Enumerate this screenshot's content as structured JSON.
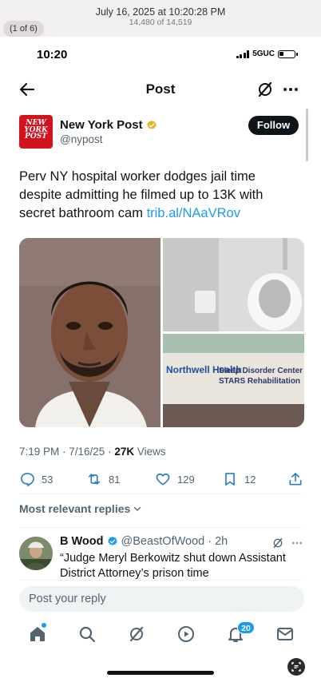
{
  "viewer": {
    "date": "July 16, 2025 at 10:20:28 PM",
    "count": "14,480 of 14,519",
    "pill": "(1 of 6)"
  },
  "status_bar": {
    "time": "10:20",
    "network": "5GUC",
    "battery_level": 0.3
  },
  "nav": {
    "title": "Post",
    "back_icon": "arrow-left-icon",
    "grok_icon": "grok-icon",
    "more_icon": "more-dots-icon"
  },
  "author": {
    "name": "New York Post",
    "handle": "@nypost",
    "avatar_text": "NEW YORK POST",
    "follow_label": "Follow",
    "verified_color": "#e8b42a"
  },
  "tweet": {
    "text": "Perv NY hospital worker dodges jail time despite admitting he filmed up to 13K with secret bathroom cam ",
    "link": "trib.al/NAaVRov",
    "timestamp": "7:19 PM · 7/16/25 · ",
    "views_count": "27K",
    "views_label": " Views"
  },
  "media": {
    "sign_logo": "Northwell Health",
    "sign_text": "Sleep Disorder Center STARS Rehabilitation"
  },
  "actions": {
    "replies": "53",
    "reposts": "81",
    "likes": "129",
    "bookmarks": "12"
  },
  "relevant_label": "Most relevant replies",
  "reply": {
    "name": "B Wood",
    "handle": "@BeastOfWood",
    "time": "· 2h",
    "text": "“Judge Meryl Berkowitz shut down Assistant District Attorney’s prison time"
  },
  "reply_input": {
    "placeholder": "Post your reply"
  },
  "tabbar": {
    "notifications_badge": "20"
  },
  "colors": {
    "accent": "#1d9bf0",
    "text": "#0f1419",
    "muted": "#536471",
    "nyp_red": "#d0131c"
  }
}
